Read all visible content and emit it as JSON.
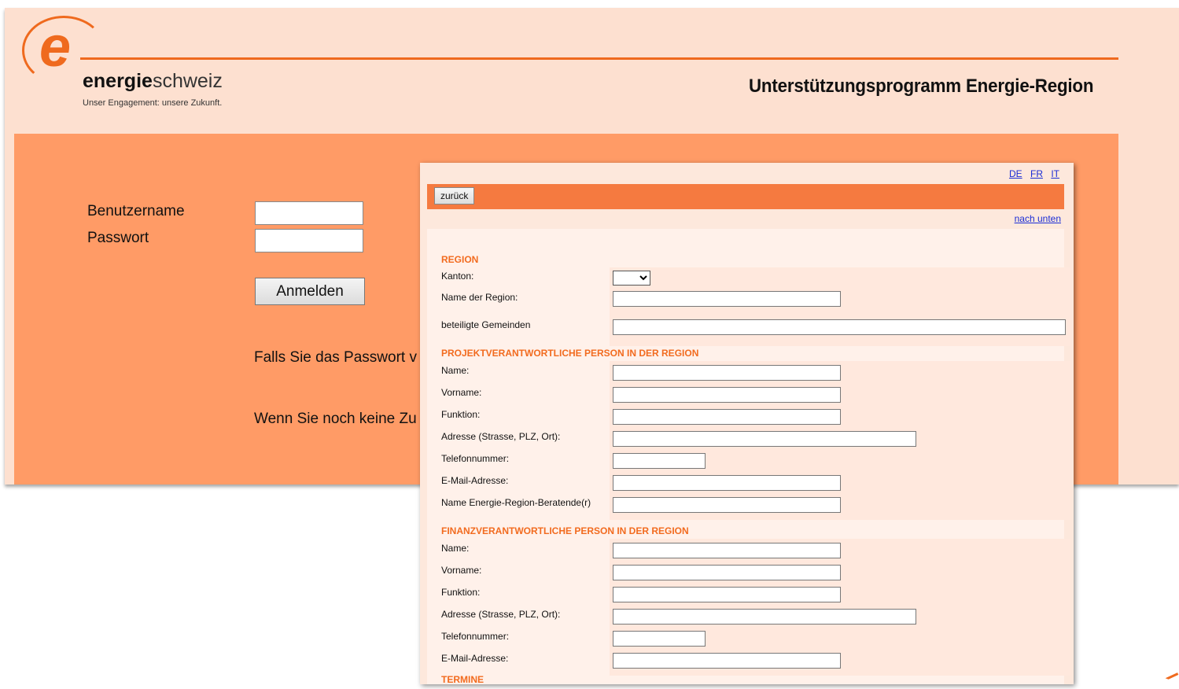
{
  "header": {
    "brand_bold": "energie",
    "brand_light": "schweiz",
    "tagline": "Unser Engagement: unsere Zukunft.",
    "program_title": "Unterstützungsprogramm Energie-Region"
  },
  "login": {
    "username_label": "Benutzername",
    "password_label": "Passwort",
    "submit_label": "Anmelden",
    "forgot_text": "Falls Sie das Passwort v",
    "noaccess_text": "Wenn Sie noch keine Zu"
  },
  "popup": {
    "languages": [
      "DE",
      "FR",
      "IT"
    ],
    "back_label": "zurück",
    "down_link": "nach unten",
    "sections": {
      "region": {
        "title": "REGION",
        "canton_label": "Kanton:",
        "region_name_label": "Name der Region:",
        "municipalities_label": "beteiligte Gemeinden"
      },
      "project_person": {
        "title": "PROJEKTVERANTWORTLICHE PERSON IN DER REGION",
        "name_label": "Name:",
        "firstname_label": "Vorname:",
        "function_label": "Funktion:",
        "address_label": "Adresse (Strasse, PLZ, Ort):",
        "phone_label": "Telefonnummer:",
        "email_label": "E-Mail-Adresse:",
        "advisor_label": "Name Energie-Region-Beratende(r)"
      },
      "finance_person": {
        "title": "FINANZVERANTWORTLICHE PERSON IN DER REGION",
        "name_label": "Name:",
        "firstname_label": "Vorname:",
        "function_label": "Funktion:",
        "address_label": "Adresse (Strasse, PLZ, Ort):",
        "phone_label": "Telefonnummer:",
        "email_label": "E-Mail-Adresse:"
      },
      "dates": {
        "title": "TERMINE"
      }
    }
  }
}
